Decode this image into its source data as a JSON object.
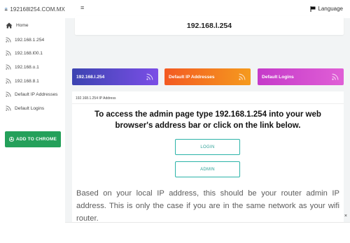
{
  "brand": {
    "name": "192168l254.COM.MX",
    "logo_icon": "wifi-router-icon"
  },
  "topbar": {
    "menu_icon": "≡",
    "language_label": "Language",
    "flag_icon": "flag-icon"
  },
  "sidebar": {
    "items": [
      {
        "label": "Home",
        "icon": "home-icon"
      },
      {
        "label": "192.168.1.254",
        "icon": "rss-icon"
      },
      {
        "label": "192.168.l00.1",
        "icon": "rss-icon"
      },
      {
        "label": "192.168.o.1",
        "icon": "rss-icon"
      },
      {
        "label": "192.168.8.1",
        "icon": "rss-icon"
      },
      {
        "label": "Default IP Addresses",
        "icon": "rss-icon"
      },
      {
        "label": "Default Logins",
        "icon": "rss-icon"
      }
    ],
    "chrome_button": "ADD TO CHROME"
  },
  "main": {
    "title": "192.168.l.254",
    "cards": [
      {
        "label": "192.168.l.254",
        "color": "#3c44b1"
      },
      {
        "label": "Default IP Addresses",
        "color": "#f35a22"
      },
      {
        "label": "Default Logins",
        "color": "#c53ac9"
      }
    ],
    "tab_label": "192.168.1.254 IP Address",
    "headline": "To access the admin page type 192.168.1.254 into your web browser's address bar or click on the link below.",
    "login_button": "LOGIN",
    "admin_button": "ADMIN",
    "paragraph": "Based on your local IP address, this should be your router admin IP address. This is only the case if you are in the same network as your wifi router."
  },
  "close_label": "×",
  "colors": {
    "accent_teal": "#2bb3a8",
    "chrome_green": "#24a05a"
  }
}
